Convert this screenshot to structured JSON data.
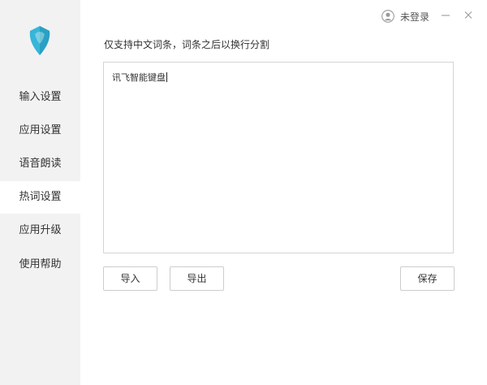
{
  "sidebar": {
    "logo_icon": "shield-logo-icon",
    "items": [
      {
        "label": "输入设置",
        "active": false
      },
      {
        "label": "应用设置",
        "active": false
      },
      {
        "label": "语音朗读",
        "active": false
      },
      {
        "label": "热词设置",
        "active": true
      },
      {
        "label": "应用升级",
        "active": false
      },
      {
        "label": "使用帮助",
        "active": false
      }
    ]
  },
  "header": {
    "user_label": "未登录",
    "user_icon": "user-avatar-icon",
    "minimize_icon": "minimize-icon",
    "close_icon": "close-icon"
  },
  "main": {
    "hint": "仅支持中文词条，词条之后以换行分割",
    "editor_value": "讯飞智能键盘",
    "buttons": {
      "import": "导入",
      "export": "导出",
      "save": "保存"
    }
  },
  "colors": {
    "sidebar_bg": "#f2f2f2",
    "logo_primary": "#36b6d8",
    "logo_dark": "#1d8fb4",
    "border": "#d4d4d4"
  }
}
